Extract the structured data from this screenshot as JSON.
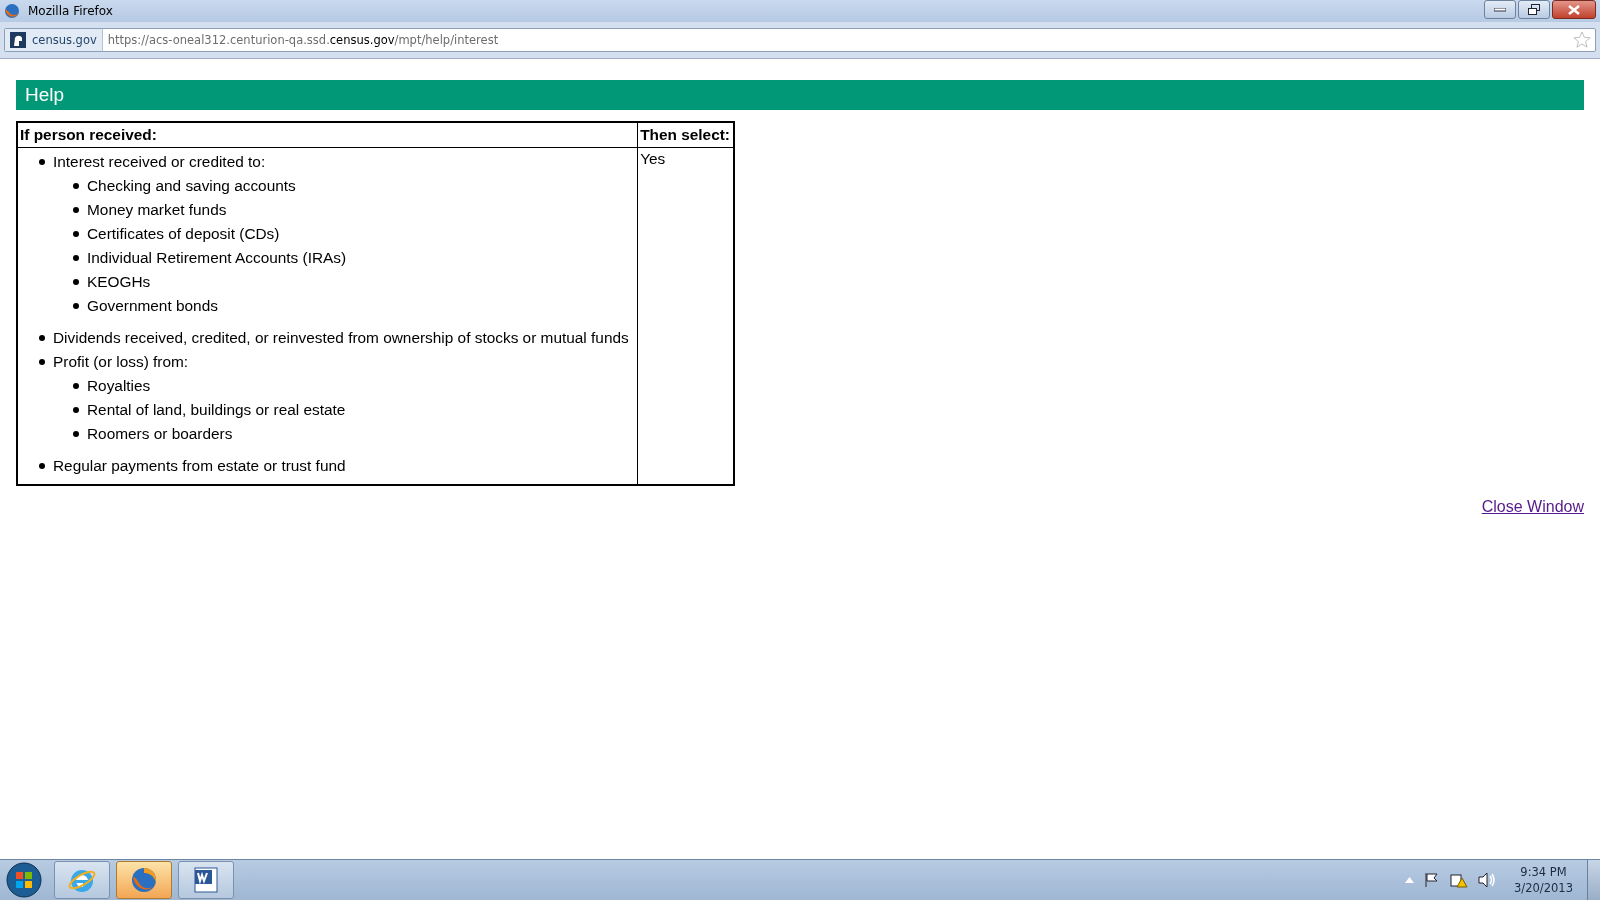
{
  "window": {
    "title": "Mozilla Firefox"
  },
  "address_bar": {
    "site_identity": "census.gov",
    "url": "https://acs-oneal312.centurion-qa.ssd.**census.gov**/mpt/help/interest"
  },
  "page": {
    "heading": "Help",
    "table": {
      "columns": [
        "If person received:",
        "Then select:"
      ],
      "rows": [
        {
          "items": [
            {
              "text": "Interest received or credited to:",
              "children": [
                {
                  "text": "Checking and saving accounts"
                },
                {
                  "text": "Money market funds"
                },
                {
                  "text": "Certificates of deposit (CDs)"
                },
                {
                  "text": "Individual Retirement Accounts (IRAs)"
                },
                {
                  "text": "KEOGHs"
                },
                {
                  "text": "Government bonds"
                }
              ]
            },
            {
              "text": "Dividends received, credited, or reinvested from ownership of stocks or mutual funds"
            },
            {
              "text": "Profit (or loss) from:",
              "children": [
                {
                  "text": "Royalties"
                },
                {
                  "text": "Rental of land, buildings or real estate"
                },
                {
                  "text": "Roomers or boarders"
                }
              ]
            },
            {
              "text": "Regular payments from estate or trust fund"
            }
          ],
          "value": "Yes"
        }
      ]
    },
    "close_link": "Close Window"
  },
  "taskbar": {
    "apps": [
      {
        "kind": "ie",
        "selected": false
      },
      {
        "kind": "firefox",
        "selected": true
      },
      {
        "kind": "word",
        "selected": false
      }
    ],
    "clock": {
      "time": "9:34 PM",
      "date": "3/20/2013"
    }
  }
}
